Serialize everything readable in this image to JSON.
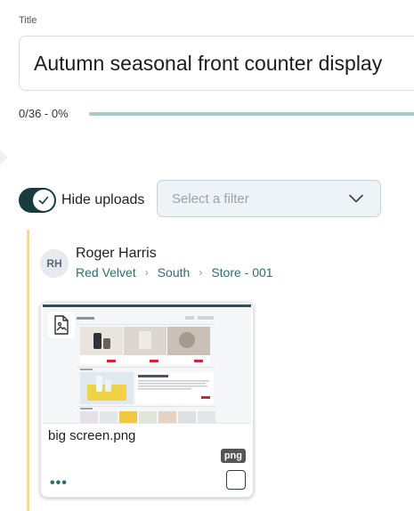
{
  "form": {
    "title_label": "Title",
    "title_value": "Autumn seasonal front counter display"
  },
  "progress": {
    "text": "0/36 - 0%",
    "fraction": 0
  },
  "controls": {
    "toggle_label": "Hide uploads",
    "toggle_on": true,
    "filter_placeholder": "Select a filter"
  },
  "upload": {
    "avatar_initials": "RH",
    "user_name": "Roger Harris",
    "breadcrumb": [
      "Red Velvet",
      "South",
      "Store - 001"
    ],
    "file": {
      "name": "big screen.png",
      "extension": "png"
    }
  },
  "colors": {
    "accent": "#2f6f6a",
    "toggle_bg": "#173b3f",
    "rail": "#f0dc9a",
    "progress_track": "#a9c8cb"
  }
}
